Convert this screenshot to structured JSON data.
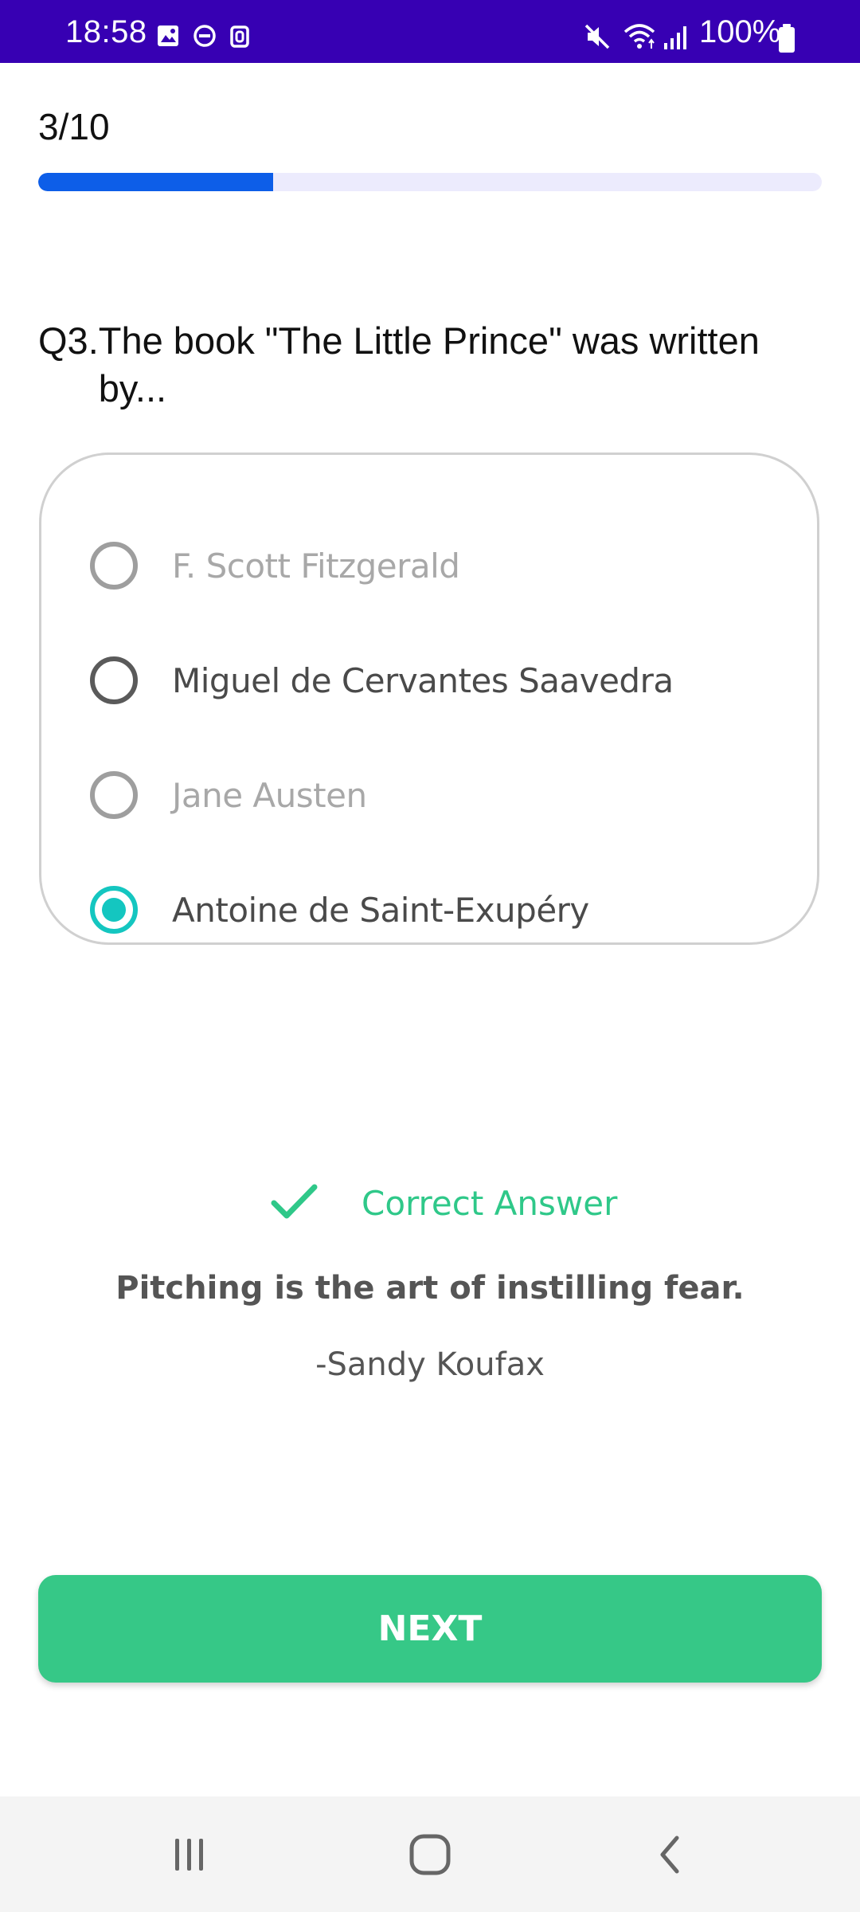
{
  "status_bar": {
    "time": "18:58",
    "battery": "100%",
    "icons": [
      "gallery-icon",
      "dnd-icon",
      "clipboard-icon",
      "mute-icon",
      "wifi-icon",
      "signal-icon",
      "battery-icon"
    ],
    "background": "#3700b3"
  },
  "progress": {
    "text": "3/10",
    "value": 0.3,
    "fill_color": "#0d5ee8",
    "track_color": "#ecebfd"
  },
  "question": {
    "number": "Q3.",
    "text": "The book \"The Little Prince\" was written by..."
  },
  "options": [
    {
      "label": "F. Scott Fitzgerald",
      "state": "disabled"
    },
    {
      "label": "Miguel de Cervantes Saavedra",
      "state": "unselected"
    },
    {
      "label": "Jane Austen",
      "state": "disabled"
    },
    {
      "label": "Antoine de Saint-Exupéry",
      "state": "selected"
    }
  ],
  "feedback": {
    "result": "Correct Answer",
    "icon": "check-icon",
    "color": "#2fc889"
  },
  "quote": {
    "text": "Pitching is the art of instilling fear.",
    "author": "-Sandy Koufax"
  },
  "next_button": {
    "label": "NEXT",
    "color": "#36c887"
  },
  "nav_bar": {
    "items": [
      "recent-apps-icon",
      "home-icon",
      "back-icon"
    ]
  }
}
